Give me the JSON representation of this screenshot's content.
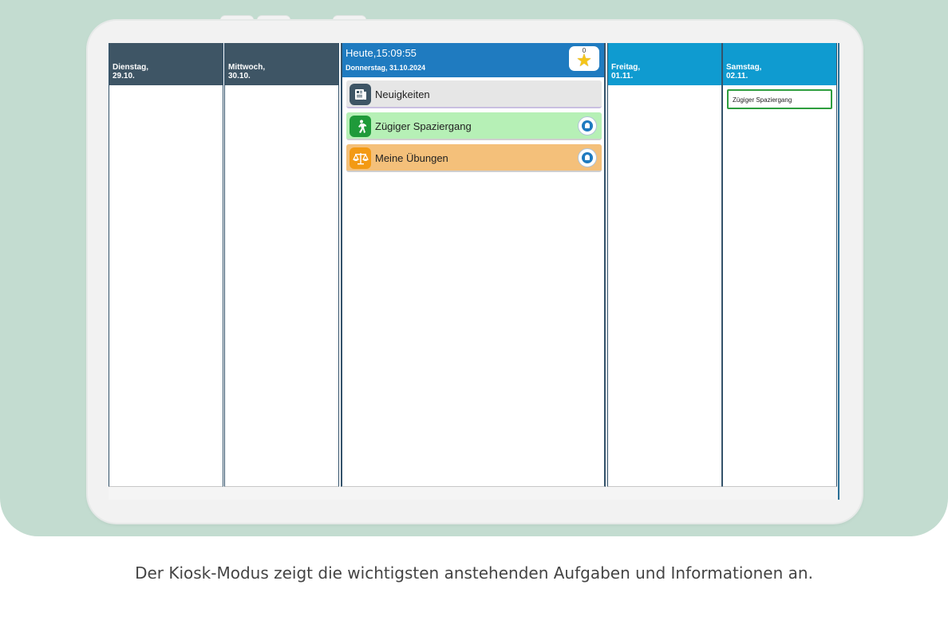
{
  "days": [
    {
      "weekday": "Dienstag,",
      "date": "29.10."
    },
    {
      "weekday": "Mittwoch,",
      "date": "30.10."
    },
    {
      "weekday": "Freitag,",
      "date": "01.11."
    },
    {
      "weekday": "Samstag,",
      "date": "02.11."
    }
  ],
  "today": {
    "time": "Heute,15:09:55",
    "date": "Donnerstag, 31.10.2024",
    "star_count": "0",
    "star_icon": "star-icon"
  },
  "tasks": [
    {
      "label": "Neuigkeiten",
      "icon": "newspaper-icon",
      "color": "#e6e6e6",
      "badge": "#3e5565"
    },
    {
      "label": "Zügiger Spaziergang",
      "icon": "walking-person-icon",
      "color": "#b6f0b6",
      "badge": "#1f9a3a",
      "reminder_icon": "bell-icon"
    },
    {
      "label": "Meine Übungen",
      "icon": "scales-icon",
      "color": "#f4c07a",
      "badge": "#f39a14",
      "reminder_icon": "bell-icon"
    }
  ],
  "saturday_task": "Zügiger Spaziergang",
  "caption": "Der Kiosk-Modus zeigt die wichtigsten anstehenden Aufgaben und Informationen an."
}
